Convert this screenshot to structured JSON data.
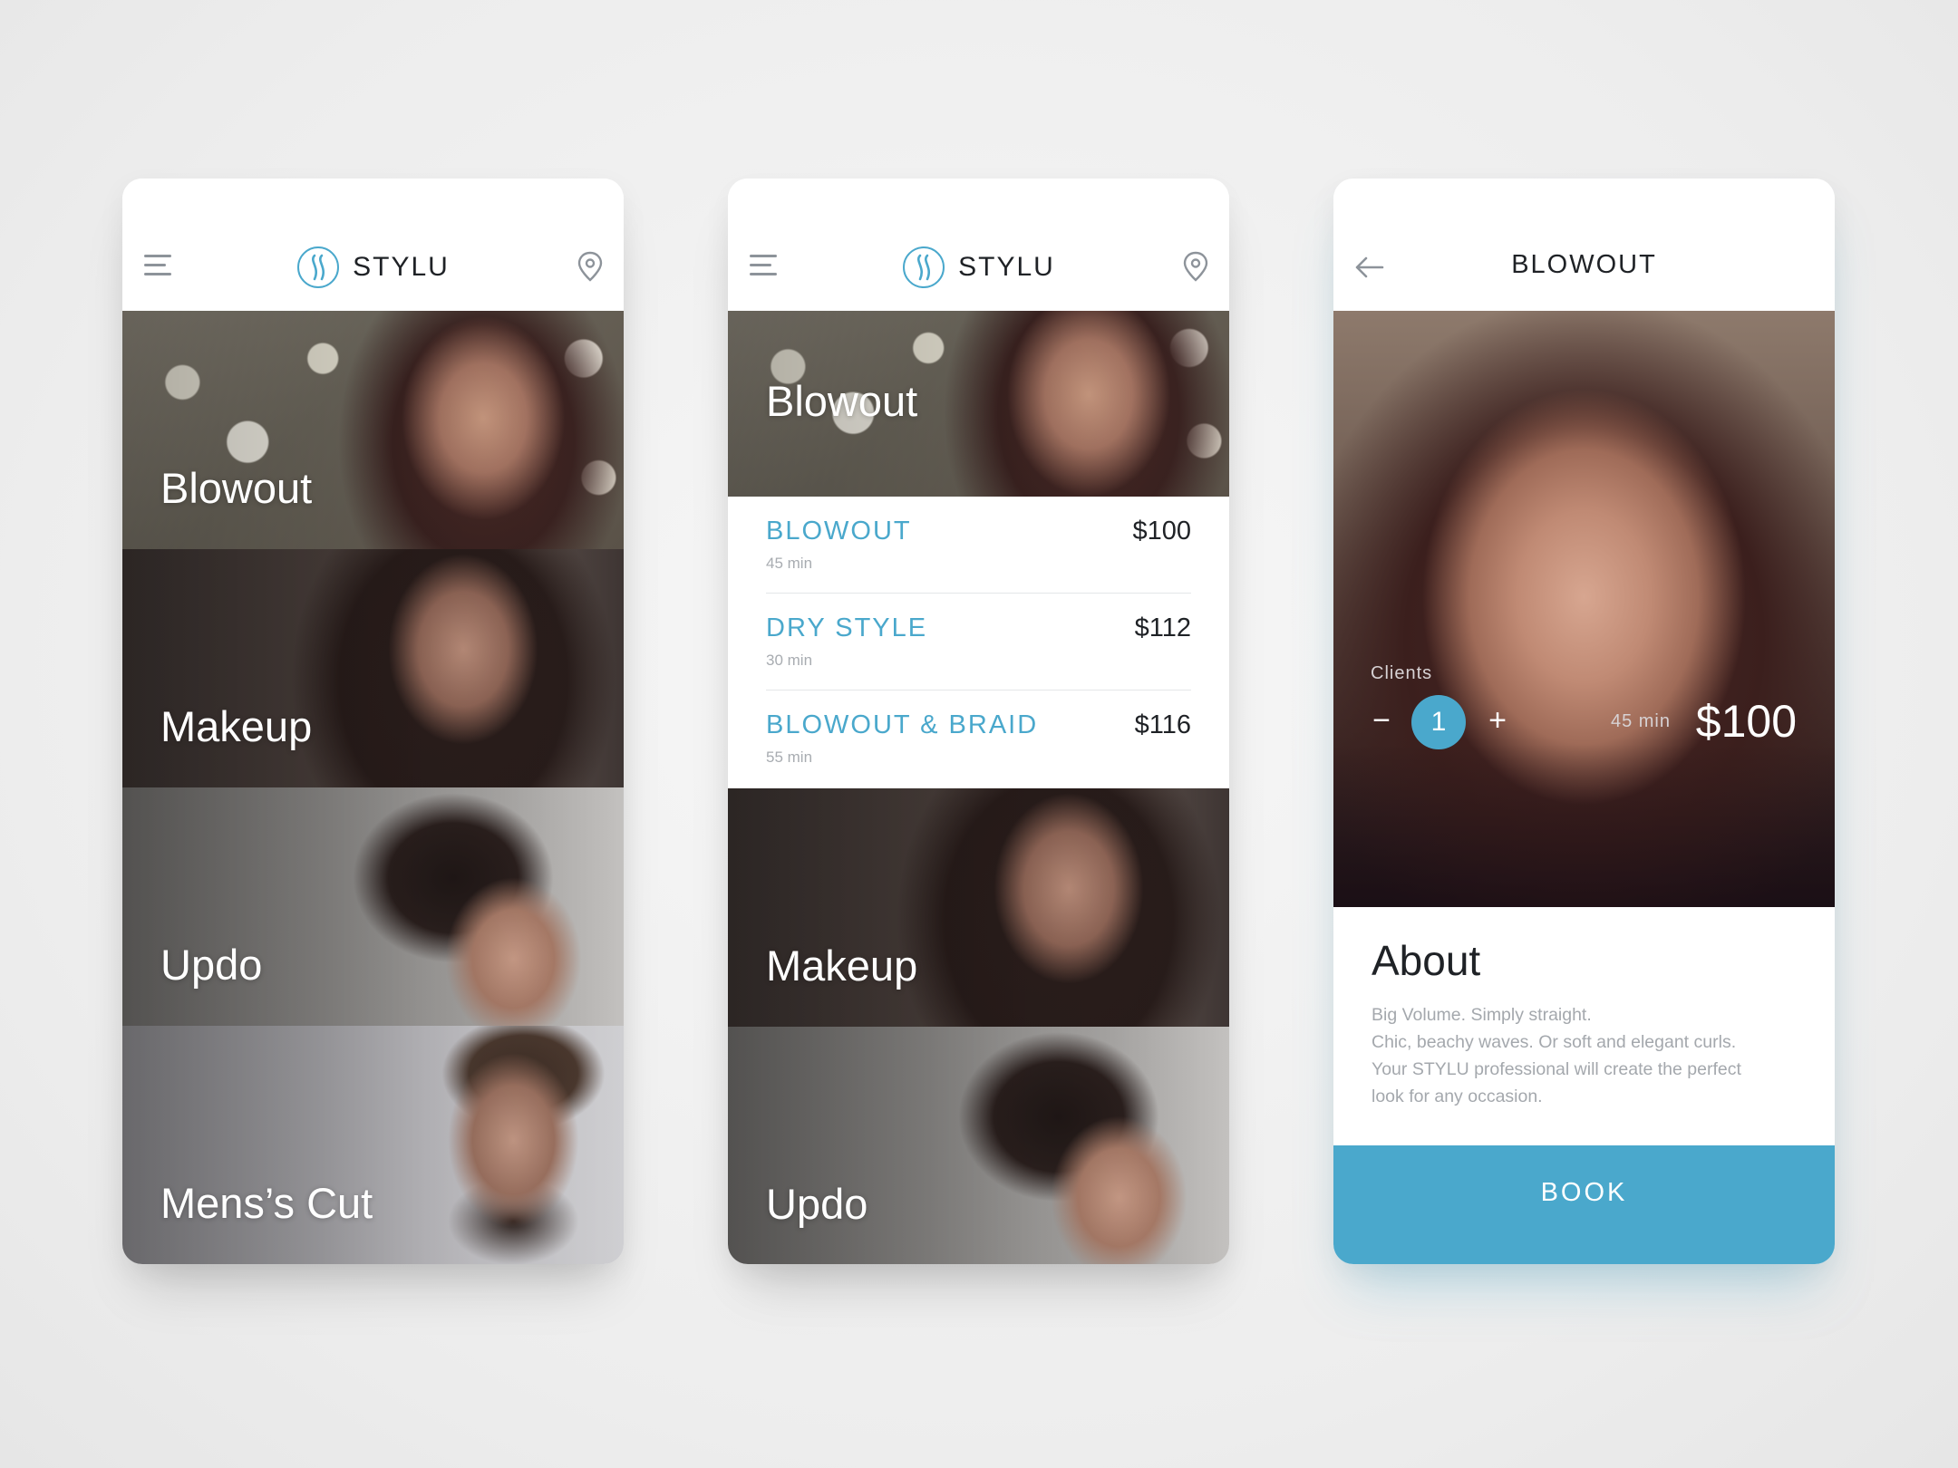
{
  "screen1": {
    "brand": "STYLU",
    "tiles": [
      {
        "label": "Blowout"
      },
      {
        "label": "Makeup"
      },
      {
        "label": "Updo"
      },
      {
        "label": "Mens’s Cut"
      }
    ]
  },
  "screen2": {
    "brand": "STYLU",
    "header_tile": {
      "label": "Blowout"
    },
    "services": [
      {
        "name": "BLOWOUT",
        "duration": "45 min",
        "price": "$100"
      },
      {
        "name": "DRY STYLE",
        "duration": "30 min",
        "price": "$112"
      },
      {
        "name": "BLOWOUT & BRAID",
        "duration": "55 min",
        "price": "$116"
      }
    ],
    "tiles": [
      {
        "label": "Makeup"
      },
      {
        "label": "Updo"
      }
    ]
  },
  "screen3": {
    "title": "BLOWOUT",
    "clients_label": "Clients",
    "minus": "−",
    "count": "1",
    "plus": "+",
    "duration": "45 min",
    "price": "$100",
    "about_title": "About",
    "about_lines": [
      "Big Volume. Simply straight.",
      "Chic, beachy waves. Or soft and elegant curls.",
      "Your STYLU professional will create the perfect",
      "look for any occasion."
    ],
    "book_label": "BOOK"
  },
  "colors": {
    "accent": "#4aa8cc",
    "text_dark": "#1f2226",
    "text_muted": "#a4a8ad",
    "background": "#efefef"
  },
  "icons": [
    "menu-icon",
    "stylu-logo-icon",
    "location-pin-icon",
    "back-arrow-icon"
  ]
}
